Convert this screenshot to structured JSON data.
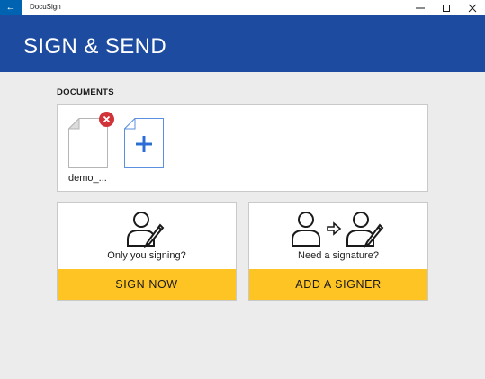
{
  "window": {
    "app_title": "DocuSign",
    "back_glyph": "←",
    "controls": [
      "minimize-icon",
      "maximize-icon",
      "close-icon"
    ]
  },
  "banner": {
    "title": "SIGN & SEND",
    "color": "#1d4b9f"
  },
  "documents": {
    "heading": "DOCUMENTS",
    "items": [
      {
        "name": "demo_..."
      }
    ],
    "add_icon": "plus-icon",
    "remove_icon": "remove-icon"
  },
  "options": [
    {
      "caption": "Only you signing?",
      "action": "SIGN NOW",
      "icon": "signer-icon"
    },
    {
      "caption": "Need a signature?",
      "action": "ADD A SIGNER",
      "icon": "send-to-signer-icon"
    }
  ],
  "colors": {
    "accent": "#fec424",
    "titlebar_accent": "#0063b1",
    "remove": "#d13438",
    "plus": "#2b6fd6"
  }
}
